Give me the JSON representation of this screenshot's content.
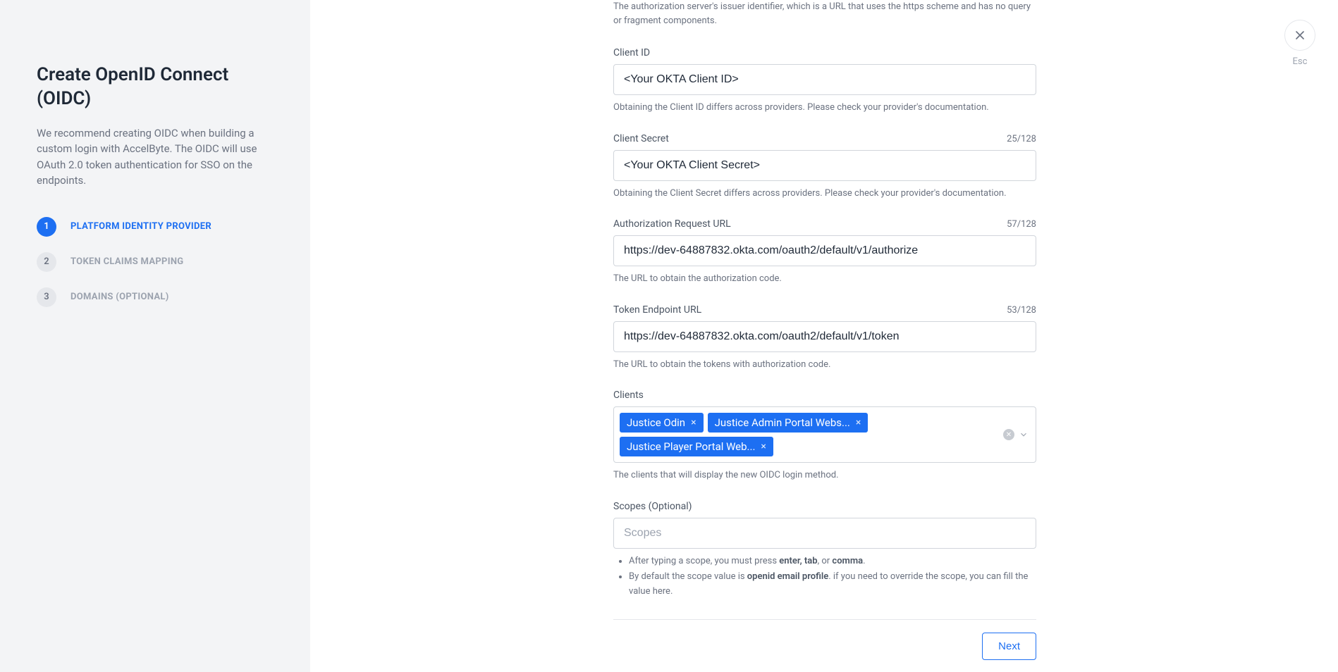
{
  "sidebar": {
    "title": "Create OpenID Connect (OIDC)",
    "description": "We recommend creating OIDC when building a custom login with AccelByte. The OIDC will use OAuth 2.0 token authentication for SSO on the endpoints.",
    "steps": [
      {
        "num": "1",
        "label": "PLATFORM IDENTITY PROVIDER",
        "active": true
      },
      {
        "num": "2",
        "label": "TOKEN CLAIMS MAPPING",
        "active": false
      },
      {
        "num": "3",
        "label": "DOMAINS (OPTIONAL)",
        "active": false
      }
    ]
  },
  "close_label": "Esc",
  "intro_help": "The authorization server's issuer identifier, which is a URL that uses the https scheme and has no query or fragment components.",
  "fields": {
    "client_id": {
      "label": "Client ID",
      "value": "<Your OKTA Client ID>",
      "help": "Obtaining the Client ID differs across providers. Please check your provider's documentation."
    },
    "client_secret": {
      "label": "Client Secret",
      "value": "<Your OKTA Client Secret>",
      "count": "25/128",
      "help": "Obtaining the Client Secret differs across providers. Please check your provider's documentation."
    },
    "auth_url": {
      "label": "Authorization Request URL",
      "value": "https://dev-64887832.okta.com/oauth2/default/v1/authorize",
      "count": "57/128",
      "help": "The URL to obtain the authorization code."
    },
    "token_url": {
      "label": "Token Endpoint URL",
      "value": "https://dev-64887832.okta.com/oauth2/default/v1/token",
      "count": "53/128",
      "help": "The URL to obtain the tokens with authorization code."
    },
    "clients": {
      "label": "Clients",
      "chips": [
        "Justice Odin",
        "Justice Admin Portal Webs...",
        "Justice Player Portal Web..."
      ],
      "help": "The clients that will display the new OIDC login method."
    },
    "scopes": {
      "label": "Scopes (Optional)",
      "placeholder": "Scopes",
      "help_items": [
        {
          "pre": "After typing a scope, you must press ",
          "bold": "enter, tab",
          "mid": ", or ",
          "bold2": "comma",
          "post": "."
        },
        {
          "pre": "By default the scope value is ",
          "bold": "openid email profile",
          "mid": "",
          "bold2": "",
          "post": ". if you need to override the scope, you can fill the value here."
        }
      ]
    }
  },
  "footer": {
    "next": "Next"
  }
}
